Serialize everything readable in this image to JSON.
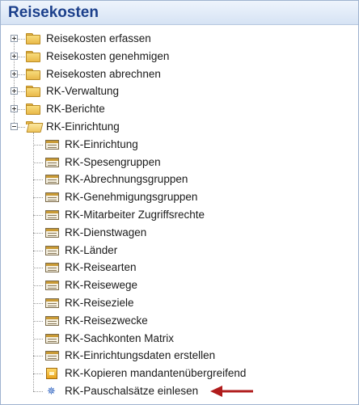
{
  "title": "Reisekosten",
  "tree": {
    "top_items": [
      {
        "label": "Reisekosten erfassen"
      },
      {
        "label": "Reisekosten genehmigen"
      },
      {
        "label": "Reisekosten abrechnen"
      },
      {
        "label": "RK-Verwaltung"
      },
      {
        "label": "RK-Berichte"
      }
    ],
    "open_folder": {
      "label": "RK-Einrichtung"
    },
    "children": [
      {
        "label": "RK-Einrichtung",
        "icon": "table-icon"
      },
      {
        "label": "RK-Spesengruppen",
        "icon": "table-icon"
      },
      {
        "label": "RK-Abrechnungsgruppen",
        "icon": "table-icon"
      },
      {
        "label": "RK-Genehmigungsgruppen",
        "icon": "table-icon"
      },
      {
        "label": "RK-Mitarbeiter Zugriffsrechte",
        "icon": "table-icon"
      },
      {
        "label": "RK-Dienstwagen",
        "icon": "table-icon"
      },
      {
        "label": "RK-Länder",
        "icon": "table-icon"
      },
      {
        "label": "RK-Reisearten",
        "icon": "table-icon"
      },
      {
        "label": "RK-Reisewege",
        "icon": "table-icon"
      },
      {
        "label": "RK-Reiseziele",
        "icon": "table-icon"
      },
      {
        "label": "RK-Reisezwecke",
        "icon": "table-icon"
      },
      {
        "label": "RK-Sachkonten Matrix",
        "icon": "table-icon"
      },
      {
        "label": "RK-Einrichtungsdaten erstellen",
        "icon": "table-icon"
      },
      {
        "label": "RK-Kopieren mandantenübergreifend",
        "icon": "copy-icon"
      },
      {
        "label": "RK-Pauschalsätze einlesen",
        "icon": "gear-icon"
      }
    ]
  },
  "colors": {
    "header_text": "#1b3f8b",
    "arrow": "#b01c1c"
  }
}
